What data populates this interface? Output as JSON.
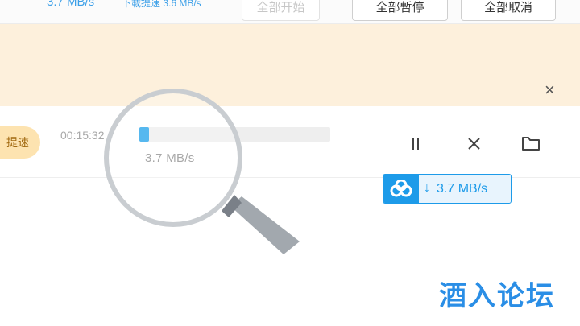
{
  "toolbar": {
    "total_speed": "3.7 MB/s",
    "accel_speed": "下載提速 3.6 MB/s",
    "start_all": "全部开始",
    "pause_all": "全部暫停",
    "cancel_all": "全部取消"
  },
  "banner": {
    "close_icon": "×"
  },
  "task": {
    "accel_label": "提速",
    "time_remaining": "00:15:32",
    "progress_fraction": 0.05,
    "speed": "3.7 MB/s",
    "badge_speed": "3.7 MB/s",
    "badge_arrow": "↓"
  },
  "icons": {
    "pause": "pause-icon",
    "cancel": "close-icon",
    "folder": "folder-icon",
    "cloud": "cloud-icon",
    "magnifier": "magnifier-icon"
  },
  "colors": {
    "accent": "#1ea0ea",
    "banner": "#fdf0dc",
    "pill": "#fde3b0",
    "watermark": "#2a8ee6"
  },
  "watermark": "酒入论坛"
}
